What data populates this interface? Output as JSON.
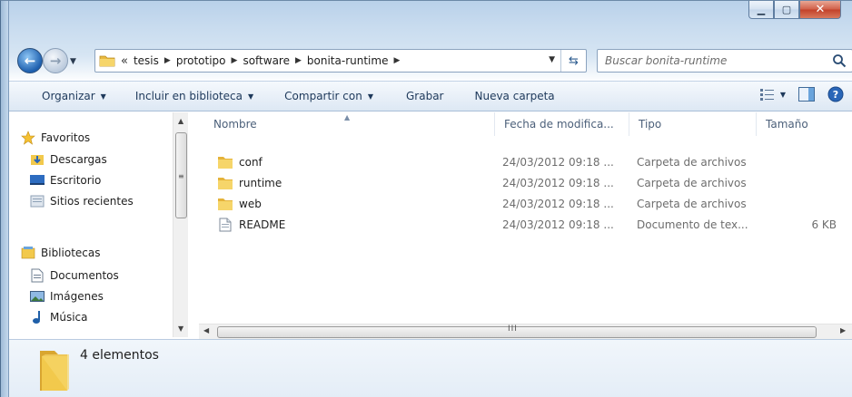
{
  "breadcrumb": {
    "overflow": "«",
    "items": [
      "tesis",
      "prototipo",
      "software",
      "bonita-runtime"
    ]
  },
  "search": {
    "placeholder": "Buscar bonita-runtime"
  },
  "toolbar": {
    "organize": "Organizar",
    "include_library": "Incluir en biblioteca",
    "share": "Compartir con",
    "burn": "Grabar",
    "new_folder": "Nueva carpeta"
  },
  "nav": {
    "favorites": "Favoritos",
    "downloads": "Descargas",
    "desktop": "Escritorio",
    "recent": "Sitios recientes",
    "libraries": "Bibliotecas",
    "documents": "Documentos",
    "images": "Imágenes",
    "music": "Música"
  },
  "columns": {
    "name": "Nombre",
    "date": "Fecha de modifica...",
    "type": "Tipo",
    "size": "Tamaño"
  },
  "files": [
    {
      "name": "conf",
      "date": "24/03/2012 09:18 ...",
      "type": "Carpeta de archivos",
      "size": "",
      "icon": "folder-icon"
    },
    {
      "name": "runtime",
      "date": "24/03/2012 09:18 ...",
      "type": "Carpeta de archivos",
      "size": "",
      "icon": "folder-icon"
    },
    {
      "name": "web",
      "date": "24/03/2012 09:18 ...",
      "type": "Carpeta de archivos",
      "size": "",
      "icon": "folder-icon"
    },
    {
      "name": "README",
      "date": "24/03/2012 09:18 ...",
      "type": "Documento de tex...",
      "size": "6 KB",
      "icon": "text-document-icon"
    }
  ],
  "details": {
    "count": "4 elementos"
  },
  "colors": {
    "folder_yellow": "#f2c94c",
    "link_blue": "#1e395b",
    "close_red": "#c8452c"
  }
}
